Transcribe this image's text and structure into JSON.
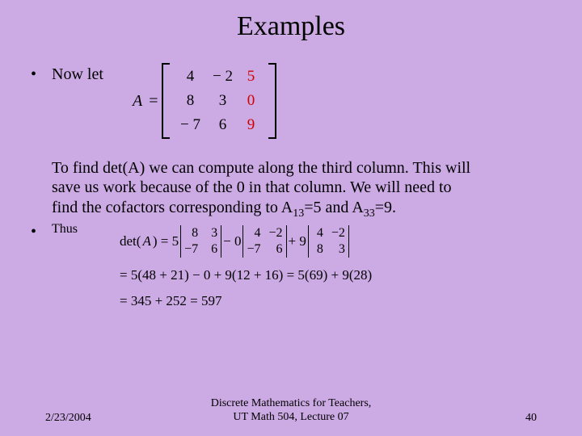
{
  "title": "Examples",
  "bullet1_label": "Now let",
  "matrix": {
    "label": "A",
    "equals": "=",
    "rows": [
      [
        "4",
        "− 2",
        "5"
      ],
      [
        "8",
        "3",
        "0"
      ],
      [
        "− 7",
        "6",
        "9"
      ]
    ]
  },
  "paragraph": {
    "p1": "To find det(A) we can compute along the third column. This will",
    "p2": "save us work because of the 0 in that column. We will need to",
    "p3_a": "find the cofactors corresponding to A",
    "p3_sub1": "13",
    "p3_b": "=5 and A",
    "p3_sub2": "33",
    "p3_c": "=9."
  },
  "bullet2_label": "Thus",
  "det": {
    "lead": "det(",
    "var": "A",
    "lead2": ") = 5",
    "m1": [
      "8",
      "3",
      "−7",
      "6"
    ],
    "mid1": "− 0",
    "m2": [
      "4",
      "−2",
      "−7",
      "6"
    ],
    "mid2": "+ 9",
    "m3": [
      "4",
      "−2",
      "8",
      "3"
    ]
  },
  "line2": "= 5(48 + 21) − 0 + 9(12 + 16) = 5(69) + 9(28)",
  "line3": "= 345 + 252 = 597",
  "footer": {
    "date": "2/23/2004",
    "center1": "Discrete Mathematics for Teachers,",
    "center2": "UT Math 504, Lecture 07",
    "page": "40"
  }
}
